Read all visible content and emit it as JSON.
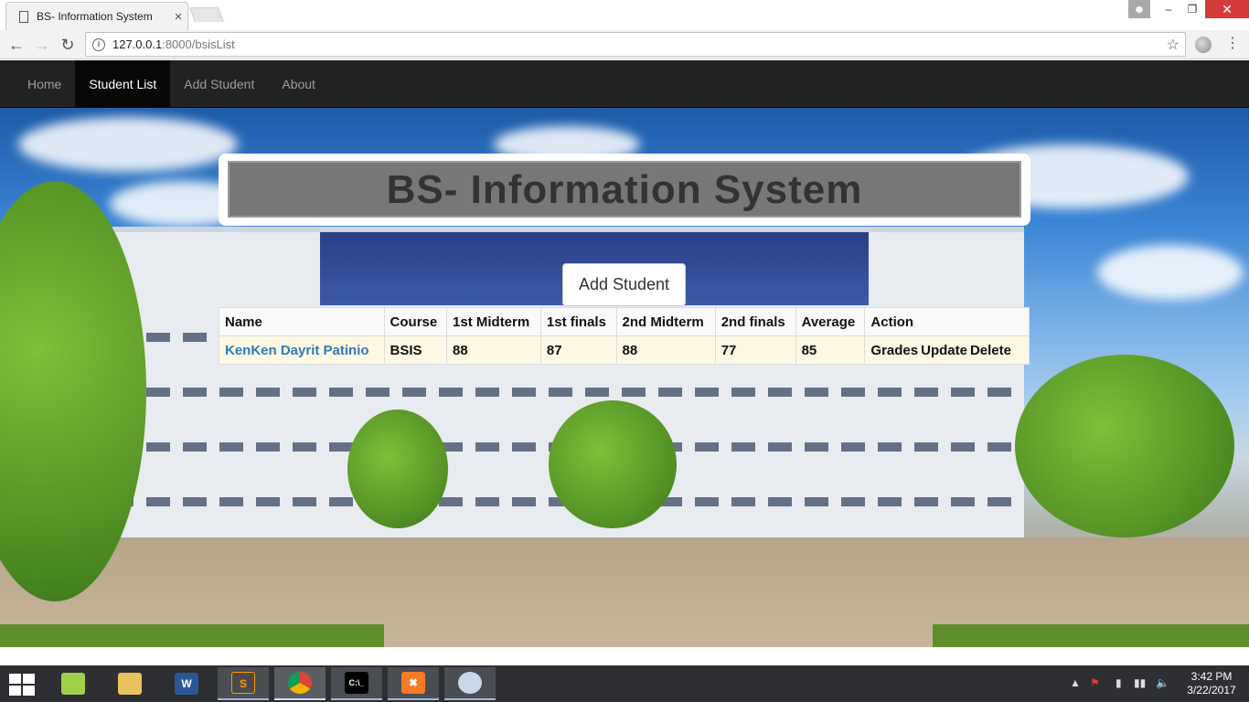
{
  "browser": {
    "tab_title": "BS- Information System",
    "tab_close": "×",
    "url_host": "127.0.0.1",
    "url_path": ":8000/bsisList",
    "window_controls": {
      "minimize": "–",
      "maximize": "❐",
      "close": "✕"
    }
  },
  "navbar": {
    "items": [
      {
        "label": "Home",
        "active": false
      },
      {
        "label": "Student List",
        "active": true
      },
      {
        "label": "Add Student",
        "active": false
      },
      {
        "label": "About",
        "active": false
      }
    ]
  },
  "page": {
    "banner_title": "BS- Information System",
    "add_button_label": "Add Student"
  },
  "table": {
    "headers": [
      "Name",
      "Course",
      "1st Midterm",
      "1st finals",
      "2nd Midterm",
      "2nd finals",
      "Average",
      "Action"
    ],
    "rows": [
      {
        "name": "KenKen Dayrit Patinio",
        "course": "BSIS",
        "midterm1": "88",
        "finals1": "87",
        "midterm2": "88",
        "finals2": "77",
        "average": "85",
        "actions": [
          "Grades",
          "Update",
          "Delete"
        ]
      }
    ]
  },
  "taskbar": {
    "time": "3:42 PM",
    "date": "3/22/2017",
    "apps": [
      "file-explorer",
      "folder",
      "word",
      "sublime-text",
      "chrome",
      "cmd",
      "xampp",
      "paint"
    ]
  },
  "colors": {
    "navbar_bg": "#222222",
    "link_blue": "#337ab7",
    "row_bg": "#fcf8e3",
    "close_red": "#d43c3c"
  }
}
